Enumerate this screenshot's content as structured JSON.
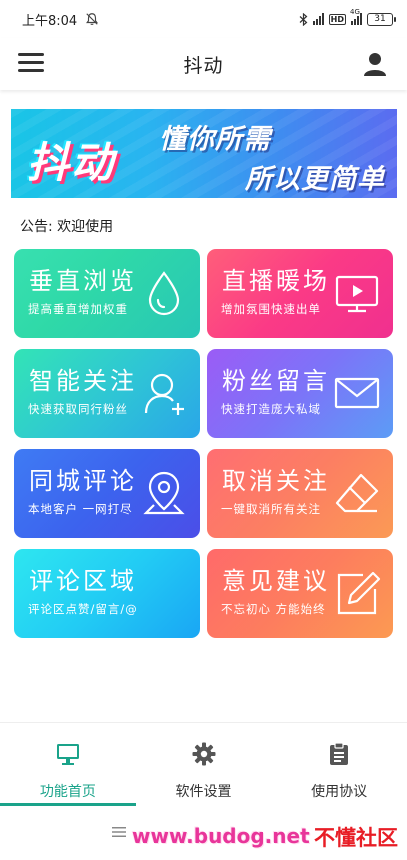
{
  "status_bar": {
    "time": "上午8:04",
    "hd_label": "HD",
    "network": "4G",
    "battery": "31"
  },
  "header": {
    "title": "抖动"
  },
  "banner": {
    "logo_text": "抖动",
    "slogan_line1": "懂你所需",
    "slogan_line2": "所以更简单"
  },
  "notice": {
    "text": "公告: 欢迎使用"
  },
  "cards": [
    {
      "title": "垂直浏览",
      "subtitle": "提高垂直增加权重",
      "icon": "water-drop-icon"
    },
    {
      "title": "直播暖场",
      "subtitle": "增加氛围快速出单",
      "icon": "tv-icon"
    },
    {
      "title": "智能关注",
      "subtitle": "快速获取同行粉丝",
      "icon": "add-user-icon"
    },
    {
      "title": "粉丝留言",
      "subtitle": "快速打造庞大私域",
      "icon": "mail-icon"
    },
    {
      "title": "同城评论",
      "subtitle": "本地客户 一网打尽",
      "icon": "location-pin-icon"
    },
    {
      "title": "取消关注",
      "subtitle": "一键取消所有关注",
      "icon": "eraser-icon"
    },
    {
      "title": "评论区域",
      "subtitle": "评论区点赞/留言/@",
      "icon": ""
    },
    {
      "title": "意见建议",
      "subtitle": "不忘初心 方能始终",
      "icon": "edit-icon"
    }
  ],
  "bottom_nav": {
    "tabs": [
      {
        "label": "功能首页",
        "icon": "monitor-icon",
        "active": true
      },
      {
        "label": "软件设置",
        "icon": "gear-icon",
        "active": false
      },
      {
        "label": "使用协议",
        "icon": "clipboard-icon",
        "active": false
      }
    ]
  },
  "watermark": {
    "url": "www.budog.net",
    "site": "不懂社区"
  },
  "colors": {
    "accent": "#1aa38a",
    "watermark_pink": "#e8359a",
    "watermark_red": "#e81d25"
  }
}
